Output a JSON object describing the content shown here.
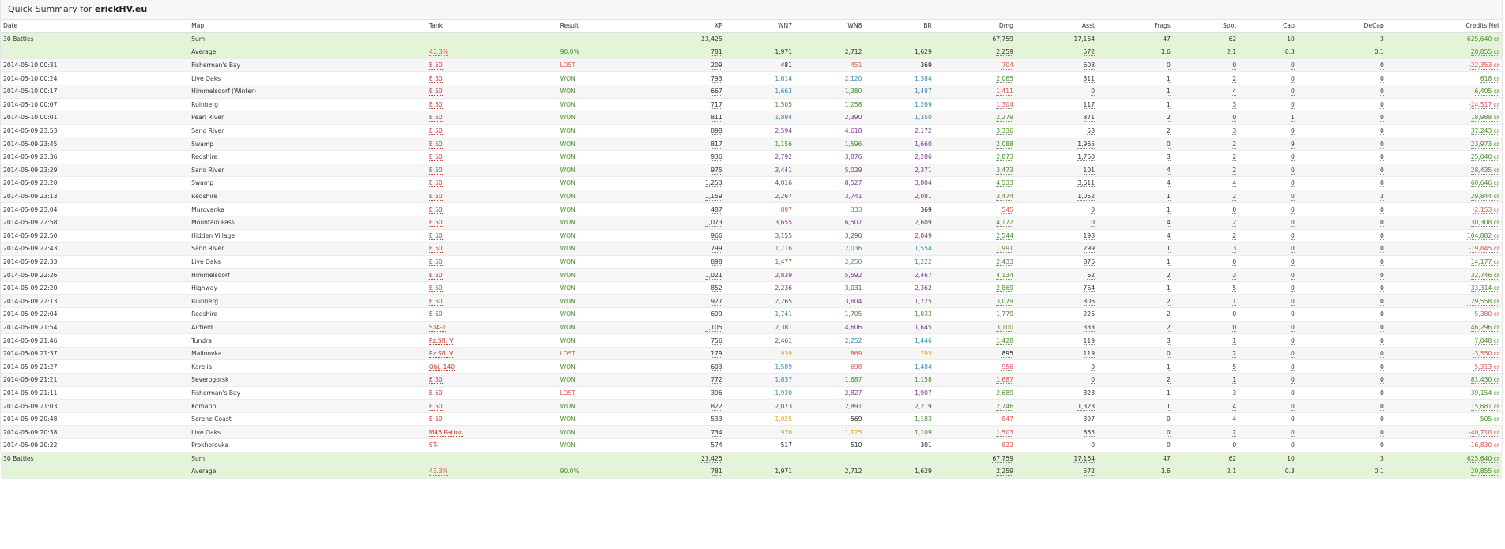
{
  "title_prefix": "Quick Summary for",
  "player": "erickHV.eu",
  "columns": [
    "Date",
    "Map",
    "Tank",
    "Result",
    "XP",
    "WN7",
    "WN8",
    "BR",
    "Dmg",
    "Asst",
    "Frags",
    "Spot",
    "Cap",
    "DeCap",
    "Credits Net"
  ],
  "summary_top": {
    "sum": {
      "date": "30 Battles",
      "map": "Sum",
      "tank": "",
      "result": "",
      "xp": "23,425",
      "wn7": "",
      "wn8": "",
      "br": "",
      "dmg": "67,759",
      "asst": "17,164",
      "frags": "47",
      "spot": "62",
      "cap": "10",
      "decap": "3",
      "credits": "625,640 cr"
    },
    "avg": {
      "date": "",
      "map": "Average",
      "tank": "43.3%",
      "result": "90.0%",
      "xp": "781",
      "wn7": "1,971",
      "wn8": "2,712",
      "br": "1,629",
      "dmg": "2,259",
      "asst": "572",
      "frags": "1.6",
      "spot": "2.1",
      "cap": "0.3",
      "decap": "0.1",
      "credits": "20,855 cr"
    }
  },
  "rows": [
    {
      "date": "2014-05-10 00:31",
      "map": "Fisherman's Bay",
      "tank": "E 50",
      "result": "LOST",
      "xp": "209",
      "wn7": "481",
      "wn8": "451",
      "br": "369",
      "dmg": "704",
      "asst": "608",
      "frags": "0",
      "spot": "0",
      "cap": "0",
      "decap": "0",
      "credits": "-22,353 cr",
      "c": {
        "wn7": "dark",
        "wn8": "red",
        "br": "dark",
        "dmg": "red",
        "credits": "red"
      }
    },
    {
      "date": "2014-05-10 00:24",
      "map": "Live Oaks",
      "tank": "E 50",
      "result": "WON",
      "xp": "793",
      "wn7": "1,614",
      "wn8": "2,120",
      "br": "1,384",
      "dmg": "2,065",
      "asst": "311",
      "frags": "1",
      "spot": "2",
      "cap": "0",
      "decap": "0",
      "credits": "618 cr",
      "c": {
        "wn7": "blue",
        "wn8": "blue",
        "br": "blue",
        "dmg": "green",
        "credits": "green"
      }
    },
    {
      "date": "2014-05-10 00:17",
      "map": "Himmelsdorf (Winter)",
      "tank": "E 50",
      "result": "WON",
      "xp": "667",
      "wn7": "1,663",
      "wn8": "1,380",
      "br": "1,487",
      "dmg": "1,411",
      "asst": "0",
      "frags": "1",
      "spot": "4",
      "cap": "0",
      "decap": "0",
      "credits": "6,405 cr",
      "c": {
        "wn7": "blue",
        "wn8": "green",
        "br": "blue",
        "dmg": "red",
        "credits": "green"
      }
    },
    {
      "date": "2014-05-10 00:07",
      "map": "Ruinberg",
      "tank": "E 50",
      "result": "WON",
      "xp": "717",
      "wn7": "1,505",
      "wn8": "1,258",
      "br": "1,269",
      "dmg": "1,304",
      "asst": "117",
      "frags": "1",
      "spot": "3",
      "cap": "0",
      "decap": "0",
      "credits": "-24,517 cr",
      "c": {
        "wn7": "green",
        "wn8": "green",
        "br": "blue",
        "dmg": "red",
        "credits": "red"
      }
    },
    {
      "date": "2014-05-10 00:01",
      "map": "Pearl River",
      "tank": "E 50",
      "result": "WON",
      "xp": "811",
      "wn7": "1,894",
      "wn8": "2,390",
      "br": "1,350",
      "dmg": "2,279",
      "asst": "871",
      "frags": "2",
      "spot": "0",
      "cap": "1",
      "decap": "0",
      "credits": "18,988 cr",
      "c": {
        "wn7": "blue",
        "wn8": "purple",
        "br": "blue",
        "dmg": "green",
        "credits": "green"
      }
    },
    {
      "date": "2014-05-09 23:53",
      "map": "Sand River",
      "tank": "E 50",
      "result": "WON",
      "xp": "898",
      "wn7": "2,594",
      "wn8": "4,618",
      "br": "2,172",
      "dmg": "3,336",
      "asst": "53",
      "frags": "2",
      "spot": "3",
      "cap": "0",
      "decap": "0",
      "credits": "37,243 cr",
      "c": {
        "wn7": "purple",
        "wn8": "purple",
        "br": "purple",
        "dmg": "green",
        "credits": "green"
      }
    },
    {
      "date": "2014-05-09 23:45",
      "map": "Swamp",
      "tank": "E 50",
      "result": "WON",
      "xp": "817",
      "wn7": "1,156",
      "wn8": "1,596",
      "br": "1,660",
      "dmg": "2,088",
      "asst": "1,965",
      "frags": "0",
      "spot": "2",
      "cap": "9",
      "decap": "0",
      "credits": "23,973 cr",
      "c": {
        "wn7": "green",
        "wn8": "green",
        "br": "purple",
        "dmg": "green",
        "credits": "green"
      }
    },
    {
      "date": "2014-05-09 23:36",
      "map": "Redshire",
      "tank": "E 50",
      "result": "WON",
      "xp": "936",
      "wn7": "2,792",
      "wn8": "3,876",
      "br": "2,286",
      "dmg": "2,873",
      "asst": "1,760",
      "frags": "3",
      "spot": "2",
      "cap": "0",
      "decap": "0",
      "credits": "25,040 cr",
      "c": {
        "wn7": "purple",
        "wn8": "purple",
        "br": "purple",
        "dmg": "green",
        "credits": "green"
      }
    },
    {
      "date": "2014-05-09 23:29",
      "map": "Sand River",
      "tank": "E 50",
      "result": "WON",
      "xp": "975",
      "wn7": "3,441",
      "wn8": "5,029",
      "br": "2,371",
      "dmg": "3,473",
      "asst": "101",
      "frags": "4",
      "spot": "2",
      "cap": "0",
      "decap": "0",
      "credits": "28,435 cr",
      "c": {
        "wn7": "purple",
        "wn8": "purple",
        "br": "purple",
        "dmg": "green",
        "credits": "green"
      }
    },
    {
      "date": "2014-05-09 23:20",
      "map": "Swamp",
      "tank": "E 50",
      "result": "WON",
      "xp": "1,253",
      "wn7": "4,016",
      "wn8": "8,527",
      "br": "3,804",
      "dmg": "4,533",
      "asst": "3,611",
      "frags": "4",
      "spot": "4",
      "cap": "0",
      "decap": "0",
      "credits": "60,646 cr",
      "c": {
        "wn7": "purple",
        "wn8": "purple",
        "br": "purple",
        "dmg": "green",
        "credits": "green"
      }
    },
    {
      "date": "2014-05-09 23:13",
      "map": "Redshire",
      "tank": "E 50",
      "result": "WON",
      "xp": "1,159",
      "wn7": "2,267",
      "wn8": "3,741",
      "br": "2,081",
      "dmg": "3,474",
      "asst": "1,052",
      "frags": "1",
      "spot": "2",
      "cap": "0",
      "decap": "3",
      "credits": "29,844 cr",
      "c": {
        "wn7": "purple",
        "wn8": "purple",
        "br": "purple",
        "dmg": "green",
        "credits": "green"
      }
    },
    {
      "date": "2014-05-09 23:04",
      "map": "Murovanka",
      "tank": "E 50",
      "result": "WON",
      "xp": "487",
      "wn7": "897",
      "wn8": "333",
      "br": "369",
      "dmg": "545",
      "asst": "0",
      "frags": "1",
      "spot": "0",
      "cap": "0",
      "decap": "0",
      "credits": "-2,153 cr",
      "c": {
        "wn7": "red",
        "wn8": "red",
        "br": "dark",
        "dmg": "red",
        "credits": "red"
      }
    },
    {
      "date": "2014-05-09 22:58",
      "map": "Mountain Pass",
      "tank": "E 50",
      "result": "WON",
      "xp": "1,073",
      "wn7": "3,655",
      "wn8": "6,507",
      "br": "2,609",
      "dmg": "4,172",
      "asst": "0",
      "frags": "4",
      "spot": "2",
      "cap": "0",
      "decap": "0",
      "credits": "30,308 cr",
      "c": {
        "wn7": "purple",
        "wn8": "purple",
        "br": "purple",
        "dmg": "green",
        "credits": "green"
      }
    },
    {
      "date": "2014-05-09 22:50",
      "map": "Hidden Village",
      "tank": "E 50",
      "result": "WON",
      "xp": "966",
      "wn7": "3,155",
      "wn8": "3,290",
      "br": "2,049",
      "dmg": "2,544",
      "asst": "198",
      "frags": "4",
      "spot": "2",
      "cap": "0",
      "decap": "0",
      "credits": "104,882 cr",
      "c": {
        "wn7": "purple",
        "wn8": "purple",
        "br": "purple",
        "dmg": "green",
        "credits": "green"
      }
    },
    {
      "date": "2014-05-09 22:43",
      "map": "Sand River",
      "tank": "E 50",
      "result": "WON",
      "xp": "799",
      "wn7": "1,716",
      "wn8": "2,036",
      "br": "1,554",
      "dmg": "1,991",
      "asst": "299",
      "frags": "1",
      "spot": "3",
      "cap": "0",
      "decap": "0",
      "credits": "-19,845 cr",
      "c": {
        "wn7": "blue",
        "wn8": "blue",
        "br": "blue",
        "dmg": "green",
        "credits": "red"
      }
    },
    {
      "date": "2014-05-09 22:33",
      "map": "Live Oaks",
      "tank": "E 50",
      "result": "WON",
      "xp": "898",
      "wn7": "1,477",
      "wn8": "2,250",
      "br": "1,222",
      "dmg": "2,433",
      "asst": "876",
      "frags": "1",
      "spot": "0",
      "cap": "0",
      "decap": "0",
      "credits": "14,177 cr",
      "c": {
        "wn7": "green",
        "wn8": "blue",
        "br": "blue",
        "dmg": "green",
        "credits": "green"
      }
    },
    {
      "date": "2014-05-09 22:26",
      "map": "Himmelsdorf",
      "tank": "E 50",
      "result": "WON",
      "xp": "1,021",
      "wn7": "2,839",
      "wn8": "5,592",
      "br": "2,467",
      "dmg": "4,134",
      "asst": "62",
      "frags": "2",
      "spot": "3",
      "cap": "0",
      "decap": "0",
      "credits": "32,746 cr",
      "c": {
        "wn7": "purple",
        "wn8": "purple",
        "br": "purple",
        "dmg": "green",
        "credits": "green"
      }
    },
    {
      "date": "2014-05-09 22:20",
      "map": "Highway",
      "tank": "E 50",
      "result": "WON",
      "xp": "852",
      "wn7": "2,236",
      "wn8": "3,031",
      "br": "2,362",
      "dmg": "2,869",
      "asst": "764",
      "frags": "1",
      "spot": "5",
      "cap": "0",
      "decap": "0",
      "credits": "33,314 cr",
      "c": {
        "wn7": "purple",
        "wn8": "purple",
        "br": "purple",
        "dmg": "green",
        "credits": "green"
      }
    },
    {
      "date": "2014-05-09 22:13",
      "map": "Ruinberg",
      "tank": "E 50",
      "result": "WON",
      "xp": "927",
      "wn7": "2,265",
      "wn8": "3,604",
      "br": "1,725",
      "dmg": "3,079",
      "asst": "306",
      "frags": "2",
      "spot": "1",
      "cap": "0",
      "decap": "0",
      "credits": "129,558 cr",
      "c": {
        "wn7": "purple",
        "wn8": "purple",
        "br": "purple",
        "dmg": "green",
        "credits": "green"
      }
    },
    {
      "date": "2014-05-09 22:04",
      "map": "Redshire",
      "tank": "E 50",
      "result": "WON",
      "xp": "699",
      "wn7": "1,741",
      "wn8": "1,705",
      "br": "1,033",
      "dmg": "1,779",
      "asst": "226",
      "frags": "2",
      "spot": "0",
      "cap": "0",
      "decap": "0",
      "credits": "-5,380 cr",
      "c": {
        "wn7": "blue",
        "wn8": "green",
        "br": "green",
        "dmg": "green",
        "credits": "red"
      }
    },
    {
      "date": "2014-05-09 21:54",
      "map": "Airfield",
      "tank": "STA-1",
      "result": "WON",
      "xp": "1,105",
      "wn7": "2,381",
      "wn8": "4,606",
      "br": "1,645",
      "dmg": "3,100",
      "asst": "333",
      "frags": "2",
      "spot": "0",
      "cap": "0",
      "decap": "0",
      "credits": "46,296 cr",
      "c": {
        "wn7": "purple",
        "wn8": "purple",
        "br": "purple",
        "dmg": "green",
        "credits": "green"
      }
    },
    {
      "date": "2014-05-09 21:46",
      "map": "Tundra",
      "tank": "Pz.Sfl. V",
      "result": "WON",
      "xp": "756",
      "wn7": "2,461",
      "wn8": "2,252",
      "br": "1,446",
      "dmg": "1,428",
      "asst": "119",
      "frags": "3",
      "spot": "1",
      "cap": "0",
      "decap": "0",
      "credits": "7,048 cr",
      "c": {
        "wn7": "purple",
        "wn8": "blue",
        "br": "blue",
        "dmg": "green",
        "credits": "green"
      }
    },
    {
      "date": "2014-05-09 21:37",
      "map": "Malinovka",
      "tank": "Pz.Sfl. V",
      "result": "LOST",
      "xp": "179",
      "wn7": "939",
      "wn8": "869",
      "br": "795",
      "dmg": "895",
      "asst": "119",
      "frags": "0",
      "spot": "2",
      "cap": "0",
      "decap": "0",
      "credits": "-3,550 cr",
      "c": {
        "wn7": "orange",
        "wn8": "red",
        "br": "orange",
        "dmg": "dark",
        "credits": "red"
      }
    },
    {
      "date": "2014-05-09 21:27",
      "map": "Karelia",
      "tank": "Obj. 140",
      "result": "WON",
      "xp": "603",
      "wn7": "1,589",
      "wn8": "698",
      "br": "1,484",
      "dmg": "956",
      "asst": "0",
      "frags": "1",
      "spot": "5",
      "cap": "0",
      "decap": "0",
      "credits": "-5,313 cr",
      "c": {
        "wn7": "blue",
        "wn8": "red",
        "br": "blue",
        "dmg": "red",
        "credits": "red"
      }
    },
    {
      "date": "2014-05-09 21:21",
      "map": "Severogorsk",
      "tank": "E 50",
      "result": "WON",
      "xp": "772",
      "wn7": "1,837",
      "wn8": "1,687",
      "br": "1,158",
      "dmg": "1,687",
      "asst": "0",
      "frags": "2",
      "spot": "1",
      "cap": "0",
      "decap": "0",
      "credits": "81,430 cr",
      "c": {
        "wn7": "blue",
        "wn8": "green",
        "br": "green",
        "dmg": "red",
        "credits": "green"
      }
    },
    {
      "date": "2014-05-09 21:11",
      "map": "Fisherman's Bay",
      "tank": "E 50",
      "result": "LOST",
      "xp": "396",
      "wn7": "1,930",
      "wn8": "2,827",
      "br": "1,907",
      "dmg": "2,689",
      "asst": "828",
      "frags": "1",
      "spot": "3",
      "cap": "0",
      "decap": "0",
      "credits": "39,154 cr",
      "c": {
        "wn7": "blue",
        "wn8": "purple",
        "br": "purple",
        "dmg": "green",
        "credits": "green"
      }
    },
    {
      "date": "2014-05-09 21:03",
      "map": "Komarin",
      "tank": "E 50",
      "result": "WON",
      "xp": "822",
      "wn7": "2,073",
      "wn8": "2,891",
      "br": "2,219",
      "dmg": "2,746",
      "asst": "1,323",
      "frags": "1",
      "spot": "4",
      "cap": "0",
      "decap": "0",
      "credits": "15,681 cr",
      "c": {
        "wn7": "purple",
        "wn8": "purple",
        "br": "purple",
        "dmg": "green",
        "credits": "green"
      }
    },
    {
      "date": "2014-05-09 20:48",
      "map": "Serene Coast",
      "tank": "E 50",
      "result": "WON",
      "xp": "533",
      "wn7": "1,025",
      "wn8": "569",
      "br": "1,183",
      "dmg": "847",
      "asst": "397",
      "frags": "0",
      "spot": "4",
      "cap": "0",
      "decap": "0",
      "credits": "505 cr",
      "c": {
        "wn7": "orange",
        "wn8": "dark",
        "br": "green",
        "dmg": "red",
        "credits": "green"
      }
    },
    {
      "date": "2014-05-09 20:38",
      "map": "Live Oaks",
      "tank": "M46 Patton",
      "result": "WON",
      "xp": "734",
      "wn7": "976",
      "wn8": "1,125",
      "br": "1,109",
      "dmg": "1,503",
      "asst": "865",
      "frags": "0",
      "spot": "2",
      "cap": "0",
      "decap": "0",
      "credits": "-40,710 cr",
      "c": {
        "wn7": "orange",
        "wn8": "orange",
        "br": "green",
        "dmg": "red",
        "credits": "red"
      }
    },
    {
      "date": "2014-05-09 20:22",
      "map": "Prokhorovka",
      "tank": "ST-I",
      "result": "WON",
      "xp": "574",
      "wn7": "517",
      "wn8": "510",
      "br": "301",
      "dmg": "822",
      "asst": "0",
      "frags": "0",
      "spot": "0",
      "cap": "0",
      "decap": "0",
      "credits": "-16,830 cr",
      "c": {
        "wn7": "dark",
        "wn8": "dark",
        "br": "dark",
        "dmg": "red",
        "credits": "red"
      }
    }
  ],
  "summary_bottom": {
    "sum": {
      "date": "30 Battles",
      "map": "Sum",
      "tank": "",
      "result": "",
      "xp": "23,425",
      "wn7": "",
      "wn8": "",
      "br": "",
      "dmg": "67,759",
      "asst": "17,164",
      "frags": "47",
      "spot": "62",
      "cap": "10",
      "decap": "3",
      "credits": "625,640 cr"
    },
    "avg": {
      "date": "",
      "map": "Average",
      "tank": "43.3%",
      "result": "90.0%",
      "xp": "781",
      "wn7": "1,971",
      "wn8": "2,712",
      "br": "1,629",
      "dmg": "2,259",
      "asst": "572",
      "frags": "1.6",
      "spot": "2.1",
      "cap": "0.3",
      "decap": "0.1",
      "credits": "20,855 cr"
    }
  }
}
